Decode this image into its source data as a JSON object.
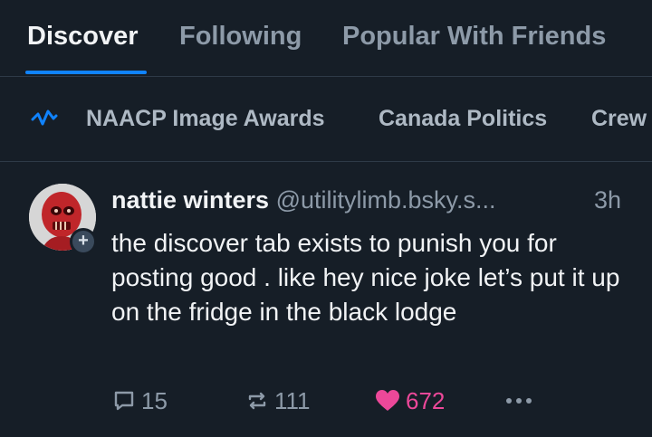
{
  "tabs": [
    {
      "label": "Discover",
      "active": true
    },
    {
      "label": "Following",
      "active": false
    },
    {
      "label": "Popular With Friends",
      "active": false
    }
  ],
  "feeds": {
    "icon": "trending-wave-icon",
    "items": [
      "NAACP Image Awards",
      "Canada Politics",
      "Crew"
    ]
  },
  "post": {
    "avatar_icon": "red-skull-avatar",
    "display_name": "nattie winters",
    "handle": "@utilitylimb.bsky.s...",
    "timestamp": "3h",
    "text": "the discover tab exists to punish you for posting good . like hey nice joke let’s put it up on the fridge in the black lodge",
    "replies": "15",
    "reposts": "111",
    "likes": "672",
    "liked": true
  },
  "colors": {
    "background": "#161e27",
    "accent": "#1083fe",
    "like": "#ec4899",
    "muted": "#8d9aa8"
  }
}
